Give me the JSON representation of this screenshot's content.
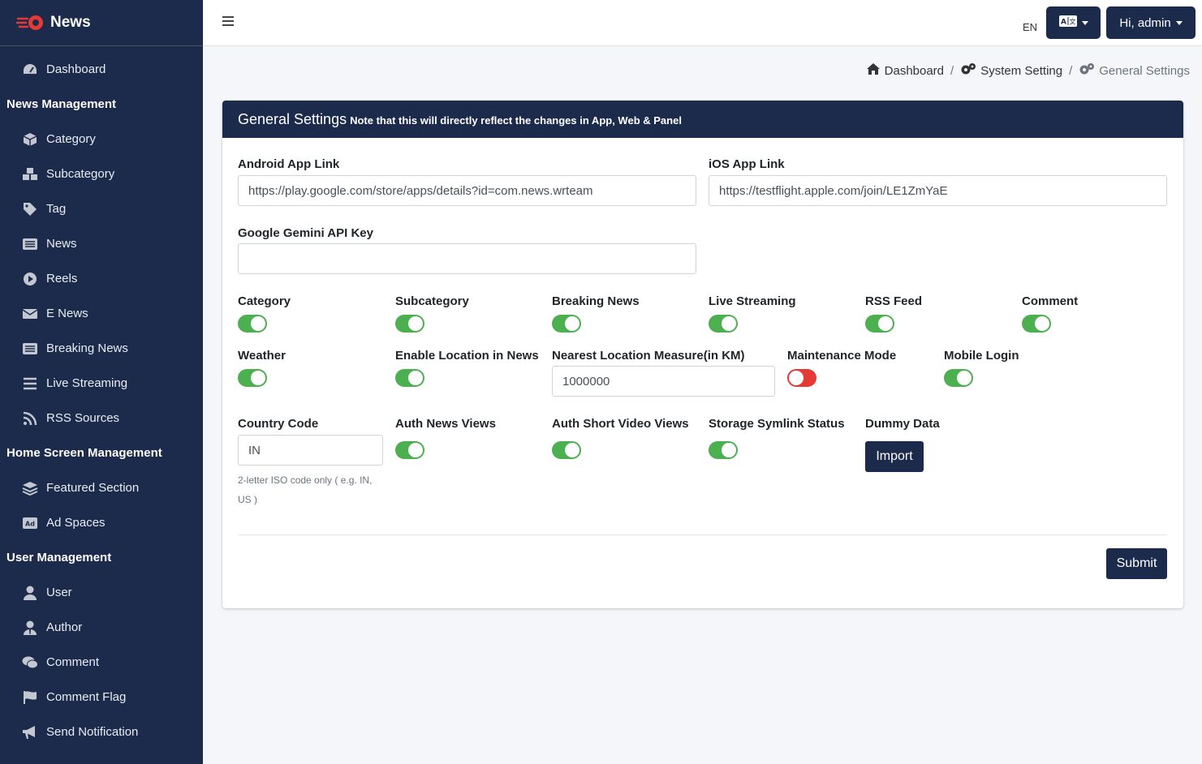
{
  "brand": {
    "name": "News"
  },
  "topbar": {
    "lang_code": "EN",
    "user_label": "Hi, admin"
  },
  "sidebar": {
    "dashboard": "Dashboard",
    "sections": [
      {
        "title": "News Management",
        "items": [
          "Category",
          "Subcategory",
          "Tag",
          "News",
          "Reels",
          "E News",
          "Breaking News",
          "Live Streaming",
          "RSS Sources"
        ]
      },
      {
        "title": "Home Screen Management",
        "items": [
          "Featured Section",
          "Ad Spaces"
        ]
      },
      {
        "title": "User Management",
        "items": [
          "User",
          "Author",
          "Comment",
          "Comment Flag",
          "Send Notification"
        ]
      }
    ]
  },
  "breadcrumb": {
    "home": "Dashboard",
    "parent": "System Setting",
    "current": "General Settings",
    "separator": "/"
  },
  "card": {
    "title": "General Settings",
    "note": "Note that this will directly reflect the changes in App, Web & Panel"
  },
  "form": {
    "android_label": "Android App Link",
    "android_value": "https://play.google.com/store/apps/details?id=com.news.wrteam",
    "ios_label": "iOS App Link",
    "ios_value": "https://testflight.apple.com/join/LE1ZmYaE",
    "gemini_label": "Google Gemini API Key",
    "gemini_value": "",
    "toggles_row1": [
      {
        "label": "Category",
        "on": true
      },
      {
        "label": "Subcategory",
        "on": true
      },
      {
        "label": "Breaking News",
        "on": true
      },
      {
        "label": "Live Streaming",
        "on": true
      },
      {
        "label": "RSS Feed",
        "on": true
      },
      {
        "label": "Comment",
        "on": true
      }
    ],
    "weather_label": "Weather",
    "location_label": "Enable Location in News",
    "nearest_label": "Nearest Location Measure(in KM)",
    "nearest_value": "1000000",
    "maintenance_label": "Maintenance Mode",
    "mobile_login_label": "Mobile Login",
    "country_label": "Country Code",
    "country_value": "IN",
    "country_help": "2-letter ISO code only ( e.g. IN, US )",
    "auth_news_label": "Auth News Views",
    "auth_short_label": "Auth Short Video Views",
    "symlink_label": "Storage Symlink Status",
    "dummy_label": "Dummy Data",
    "import_label": "Import",
    "submit_label": "Submit"
  },
  "colors": {
    "navy": "#1c2b4c",
    "toggle_on": "#4caf50",
    "toggle_off": "#e53935",
    "brand_red": "#e53935"
  }
}
